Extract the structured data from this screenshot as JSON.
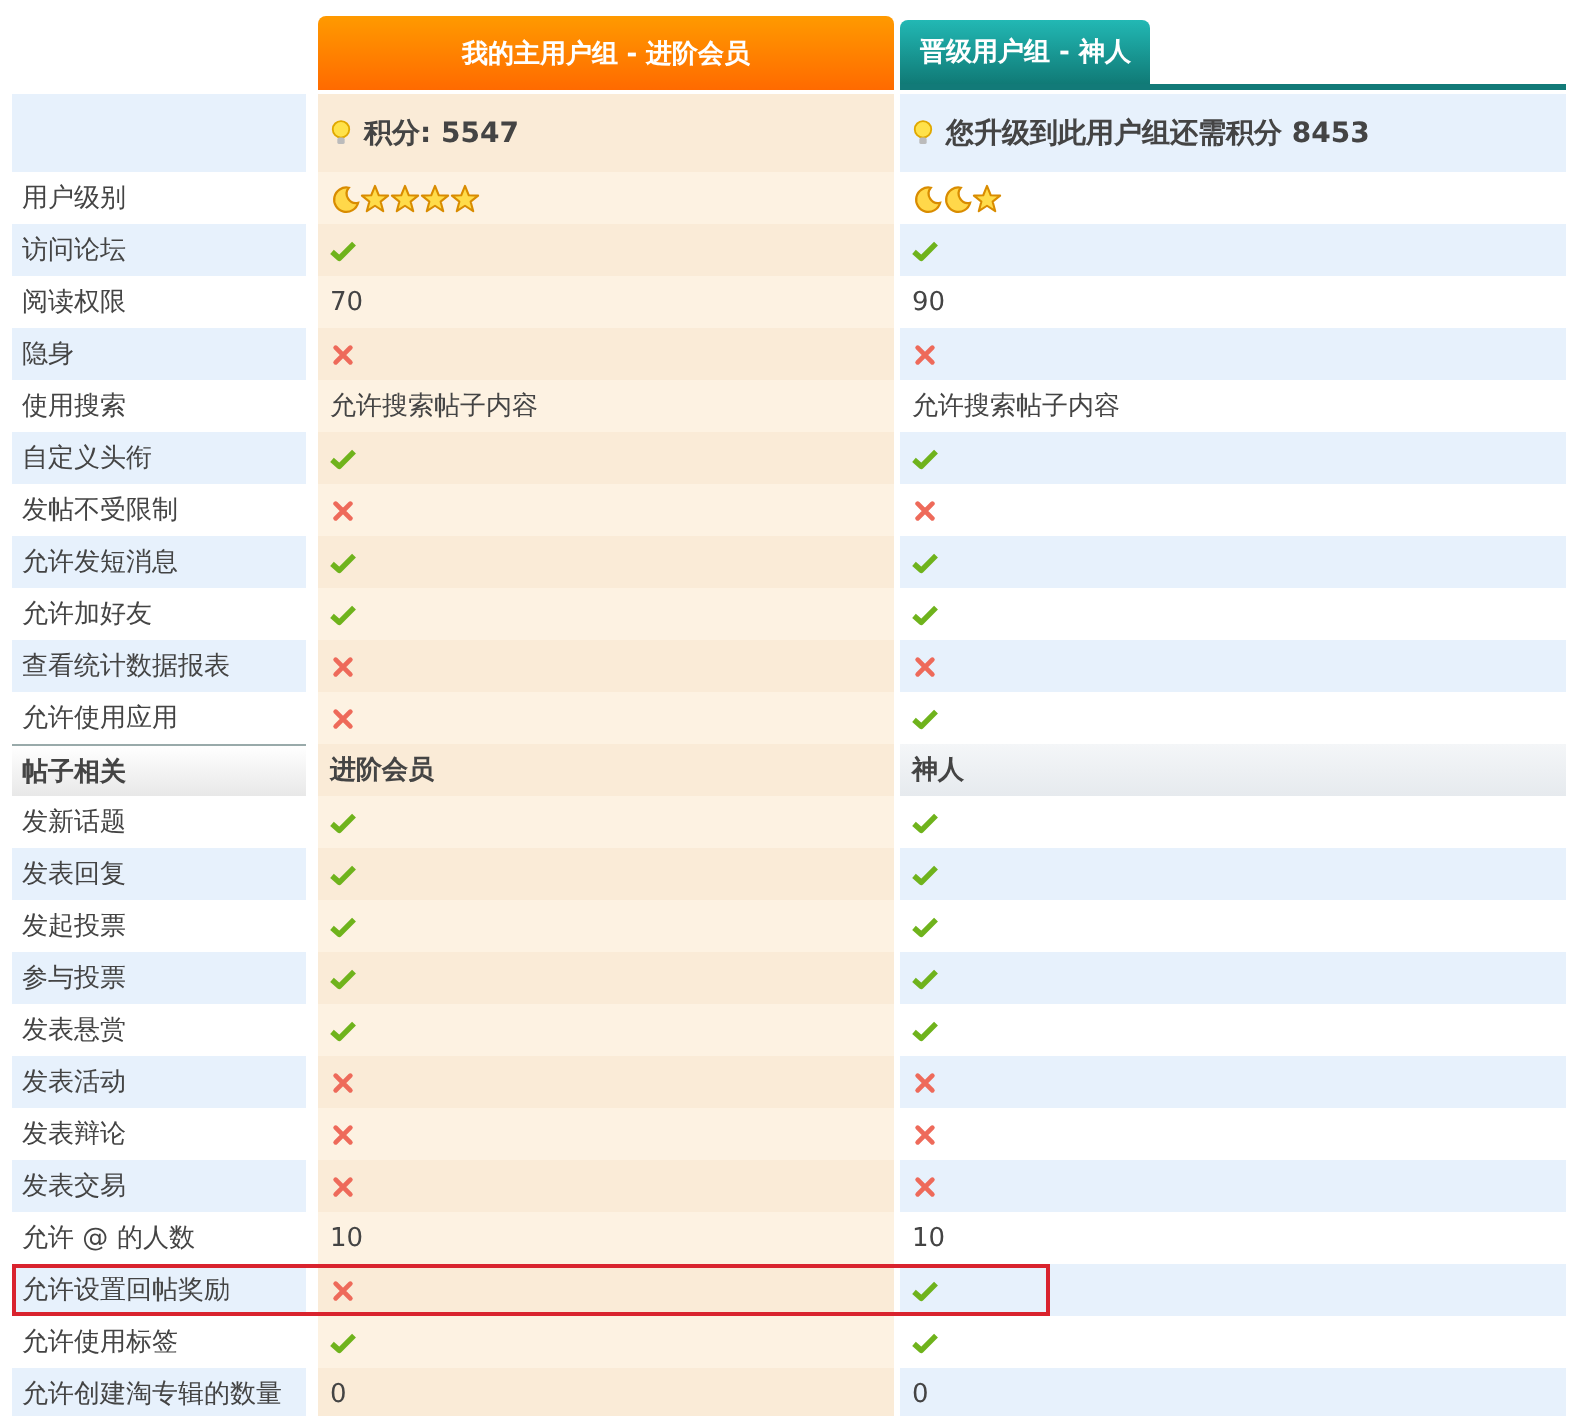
{
  "groups": [
    {
      "title": "我的主用户组 - 进阶会员",
      "kind": "current",
      "points": "积分: 5547"
    },
    {
      "title": "晋级用户组 - 神人",
      "kind": "next",
      "points": "您升级到此用户组还需积分 8453"
    }
  ],
  "rows": [
    {
      "kind": "item",
      "label": "用户级别",
      "cells": [
        {
          "kind": "rank",
          "icons": [
            {
              "kind": "moon"
            },
            {
              "kind": "star"
            },
            {
              "kind": "star"
            },
            {
              "kind": "star"
            },
            {
              "kind": "star"
            }
          ]
        },
        {
          "kind": "rank",
          "icons": [
            {
              "kind": "moon"
            },
            {
              "kind": "moon"
            },
            {
              "kind": "star"
            }
          ]
        }
      ]
    },
    {
      "kind": "item",
      "label": "访问论坛",
      "cells": [
        {
          "kind": "yes"
        },
        {
          "kind": "yes"
        }
      ]
    },
    {
      "kind": "item",
      "label": "阅读权限",
      "cells": [
        {
          "kind": "text",
          "text": "70"
        },
        {
          "kind": "text",
          "text": "90"
        }
      ]
    },
    {
      "kind": "item",
      "label": "隐身",
      "cells": [
        {
          "kind": "no"
        },
        {
          "kind": "no"
        }
      ]
    },
    {
      "kind": "item",
      "label": "使用搜索",
      "cells": [
        {
          "kind": "text",
          "text": "允许搜索帖子内容"
        },
        {
          "kind": "text",
          "text": "允许搜索帖子内容"
        }
      ]
    },
    {
      "kind": "item",
      "label": "自定义头衔",
      "cells": [
        {
          "kind": "yes"
        },
        {
          "kind": "yes"
        }
      ]
    },
    {
      "kind": "item",
      "label": "发帖不受限制",
      "cells": [
        {
          "kind": "no"
        },
        {
          "kind": "no"
        }
      ]
    },
    {
      "kind": "item",
      "label": "允许发短消息",
      "cells": [
        {
          "kind": "yes"
        },
        {
          "kind": "yes"
        }
      ]
    },
    {
      "kind": "item",
      "label": "允许加好友",
      "cells": [
        {
          "kind": "yes"
        },
        {
          "kind": "yes"
        }
      ]
    },
    {
      "kind": "item",
      "label": "查看统计数据报表",
      "cells": [
        {
          "kind": "no"
        },
        {
          "kind": "no"
        }
      ]
    },
    {
      "kind": "item",
      "label": "允许使用应用",
      "cells": [
        {
          "kind": "no"
        },
        {
          "kind": "yes"
        }
      ]
    },
    {
      "kind": "section",
      "label": "帖子相关",
      "cells": [
        {
          "kind": "text",
          "text": "进阶会员"
        },
        {
          "kind": "text",
          "text": "神人"
        }
      ]
    },
    {
      "kind": "item",
      "label": "发新话题",
      "cells": [
        {
          "kind": "yes"
        },
        {
          "kind": "yes"
        }
      ]
    },
    {
      "kind": "item",
      "label": "发表回复",
      "cells": [
        {
          "kind": "yes"
        },
        {
          "kind": "yes"
        }
      ]
    },
    {
      "kind": "item",
      "label": "发起投票",
      "cells": [
        {
          "kind": "yes"
        },
        {
          "kind": "yes"
        }
      ]
    },
    {
      "kind": "item",
      "label": "参与投票",
      "cells": [
        {
          "kind": "yes"
        },
        {
          "kind": "yes"
        }
      ]
    },
    {
      "kind": "item",
      "label": "发表悬赏",
      "cells": [
        {
          "kind": "yes"
        },
        {
          "kind": "yes"
        }
      ]
    },
    {
      "kind": "item",
      "label": "发表活动",
      "cells": [
        {
          "kind": "no"
        },
        {
          "kind": "no"
        }
      ]
    },
    {
      "kind": "item",
      "label": "发表辩论",
      "cells": [
        {
          "kind": "no"
        },
        {
          "kind": "no"
        }
      ]
    },
    {
      "kind": "item",
      "label": "发表交易",
      "cells": [
        {
          "kind": "no"
        },
        {
          "kind": "no"
        }
      ]
    },
    {
      "kind": "item",
      "label": "允许 @ 的人数",
      "cells": [
        {
          "kind": "text",
          "text": "10"
        },
        {
          "kind": "text",
          "text": "10"
        }
      ]
    },
    {
      "kind": "item",
      "label": "允许设置回帖奖励",
      "highlighted": true,
      "cells": [
        {
          "kind": "no"
        },
        {
          "kind": "yes"
        }
      ]
    },
    {
      "kind": "item",
      "label": "允许使用标签",
      "cells": [
        {
          "kind": "yes"
        },
        {
          "kind": "yes"
        }
      ]
    },
    {
      "kind": "item",
      "label": "允许创建淘专辑的数量",
      "cells": [
        {
          "kind": "text",
          "text": "0"
        },
        {
          "kind": "text",
          "text": "0"
        }
      ]
    }
  ]
}
